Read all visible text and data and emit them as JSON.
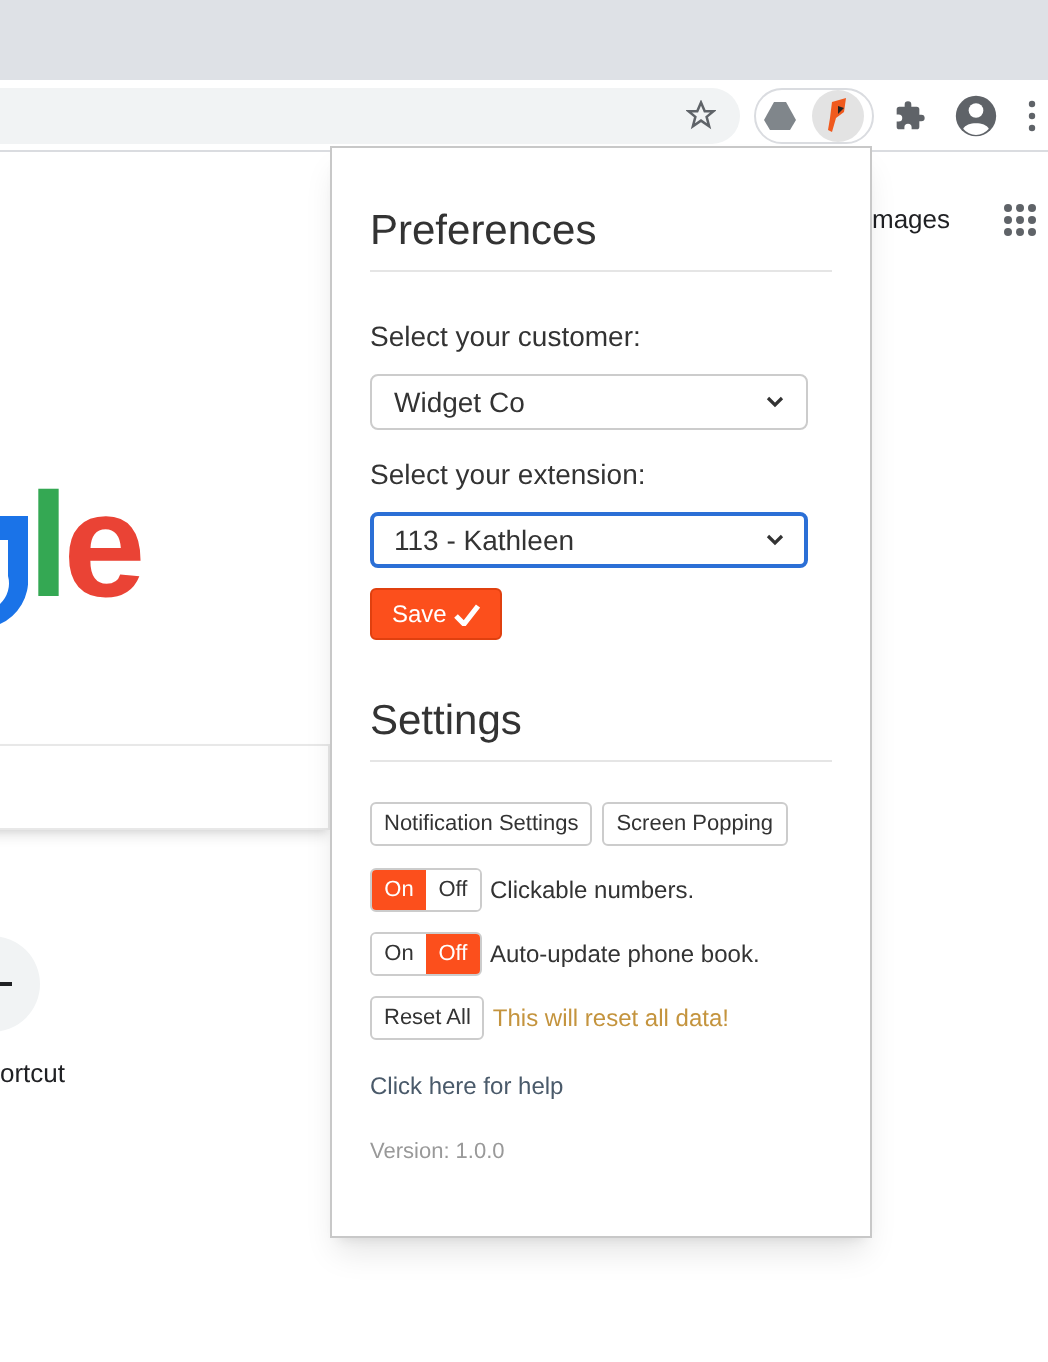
{
  "page": {
    "logo_letters": [
      {
        "text": "l",
        "color": "#34a853"
      },
      {
        "text": "e",
        "color": "#ea4335"
      }
    ],
    "images_link": "mages",
    "shortcut_label": "ortcut"
  },
  "popup": {
    "title": "Preferences",
    "fields": [
      {
        "label": "Select your customer:",
        "value": "Widget Co",
        "focused": false
      },
      {
        "label": "Select your extension:",
        "value": "113 - Kathleen",
        "focused": true
      }
    ],
    "save_button": "Save",
    "settings_title": "Settings",
    "buttons": [
      "Notification Settings",
      "Screen Popping"
    ],
    "toggles": [
      {
        "on_label": "On",
        "off_label": "Off",
        "on": true,
        "label": "Clickable numbers."
      },
      {
        "on_label": "On",
        "off_label": "Off",
        "on": false,
        "label": "Auto-update phone book."
      }
    ],
    "reset_button": "Reset All",
    "reset_warning": "This will reset all data!",
    "help_link": "Click here for help",
    "version": "Version: 1.0.0"
  }
}
